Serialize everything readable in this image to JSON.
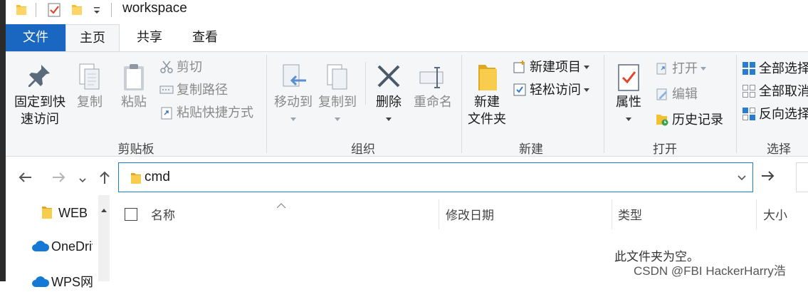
{
  "window": {
    "title": "workspace"
  },
  "tabs": {
    "file": "文件",
    "home": "主页",
    "share": "共享",
    "view": "查看"
  },
  "clipboard": {
    "pin_line1": "固定到快",
    "pin_line2": "速访问",
    "copy": "复制",
    "paste": "粘贴",
    "cut": "剪切",
    "copy_path": "复制路径",
    "paste_shortcut": "粘贴快捷方式",
    "group": "剪贴板"
  },
  "organize": {
    "move_to": "移动到",
    "copy_to": "复制到",
    "delete": "删除",
    "rename": "重命名",
    "group": "组织"
  },
  "new": {
    "new_folder_line1": "新建",
    "new_folder_line2": "文件夹",
    "new_item": "新建项目",
    "easy_access": "轻松访问",
    "group": "新建"
  },
  "open": {
    "properties": "属性",
    "open": "打开",
    "edit": "编辑",
    "history": "历史记录",
    "group": "打开"
  },
  "select": {
    "select_all": "全部选择",
    "select_none": "全部取消",
    "invert": "反向选择",
    "group": "选择"
  },
  "address": {
    "path": "cmd"
  },
  "nav": {
    "items": [
      "WEB",
      "OneDrive",
      "WPS网盘"
    ]
  },
  "columns": {
    "name": "名称",
    "modified": "修改日期",
    "type": "类型",
    "size": "大小"
  },
  "content": {
    "empty_message": "此文件夹为空。"
  },
  "watermark": "CSDN @FBI HackerHarry浩",
  "colors": {
    "accent": "#1a67c1",
    "folder": "#f3c033",
    "ribbon_bg": "#f5f6f7",
    "focus_border": "#1a7fd4"
  }
}
